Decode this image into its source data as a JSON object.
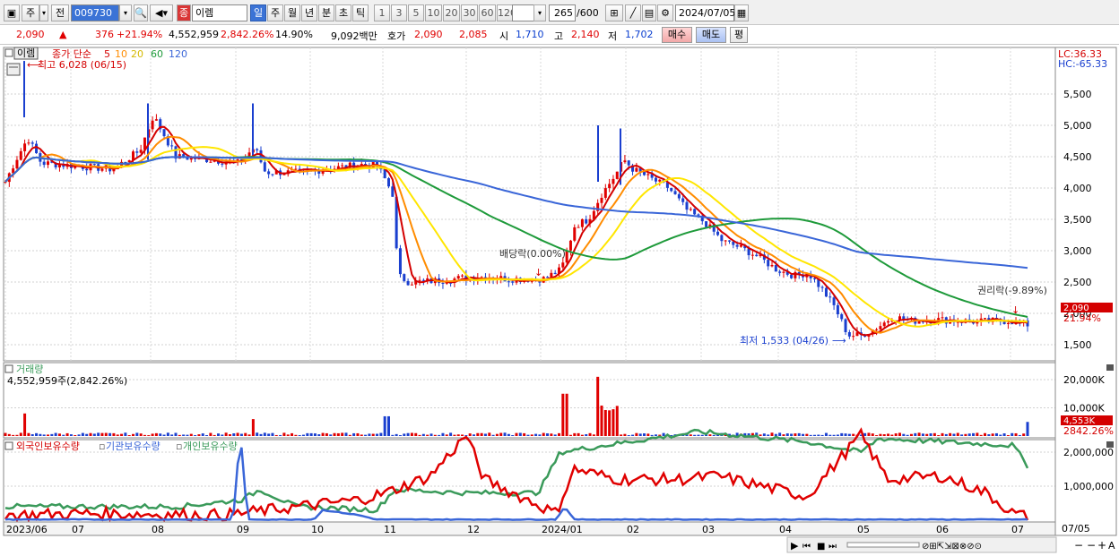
{
  "toolbar": {
    "mode": "주",
    "prev": "전",
    "code": "009730",
    "stock_icon": "종",
    "stock_name": "이렘",
    "periods": [
      "일",
      "주",
      "월",
      "년",
      "분",
      "초",
      "틱"
    ],
    "intervals": [
      "1",
      "3",
      "5",
      "10",
      "20",
      "30",
      "60",
      "120"
    ],
    "count": "265",
    "count_total": "/600",
    "date": "2024/07/05"
  },
  "quote": {
    "price": "2,090",
    "up_mark": "▲",
    "change": "376",
    "change_pct": "+21.94%",
    "volume": "4,552,959",
    "volume_pct": "2,842.26%",
    "turnover": "14.90%",
    "amount": "9,092백만",
    "bid_label": "호가",
    "ask": "2,090",
    "bid": "2,085",
    "open_label": "시",
    "open": "1,710",
    "high_label": "고",
    "high": "2,140",
    "low_label": "저",
    "low": "1,702",
    "buy_button": "매수",
    "sell_button": "매도",
    "eval_button": "평"
  },
  "price_panel": {
    "name": "이렘",
    "ma_label": "종가 단순",
    "ma_periods": [
      "5",
      "10",
      "20",
      "60",
      "120"
    ],
    "max_label": "최고 6,028 (06/15)",
    "min_label": "최저 1,533 (04/26)",
    "dividend_label": "배당락(0.00%)",
    "rights_label": "권리락(-9.89%)",
    "lc": "LC:36.33",
    "hc": "HC:-65.33",
    "yticks": [
      "5,500",
      "5,000",
      "4,500",
      "4,000",
      "3,500",
      "3,000",
      "2,500",
      "2,000",
      "1,500"
    ],
    "last_price": "2,090",
    "last_pct": "21.94%"
  },
  "volume_panel": {
    "title": "거래량",
    "value": "4,552,959주(2,842.26%)",
    "yticks": [
      "20,000K",
      "10,000K"
    ],
    "last_volume": "4,553K",
    "last_pct": "2842.26%"
  },
  "holding_panel": {
    "legend": [
      "외국인보유수량",
      "기관보유수량",
      "개인보유수량"
    ],
    "yticks": [
      "2,000,000",
      "1,000,000"
    ]
  },
  "x_axis": {
    "labels": [
      "2023/06",
      "07",
      "08",
      "09",
      "10",
      "11",
      "12",
      "2024/01",
      "02",
      "03",
      "04",
      "05",
      "06",
      "07"
    ],
    "right_label": "07/05"
  },
  "colors": {
    "ma5": "#d40000",
    "ma10": "#ff8c00",
    "ma20": "#ffe600",
    "ma60": "#1e9a3a",
    "ma120": "#3a66d8",
    "up": "#e00000",
    "down": "#1a3fcf",
    "foreign": "#e00000",
    "institution": "#3a66d8",
    "individual": "#3a9a5a"
  }
}
